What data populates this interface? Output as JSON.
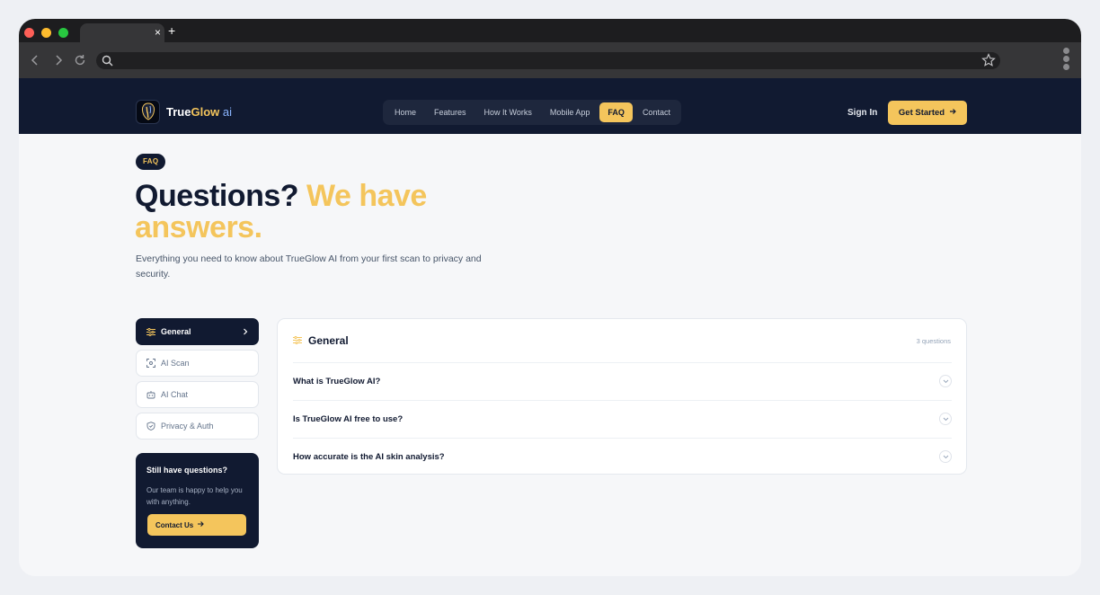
{
  "browser": {
    "tab_close": "×",
    "new_tab": "+"
  },
  "header": {
    "logo": {
      "brand_part1": "True",
      "brand_part2": "Glow",
      "brand_part3": " ai"
    },
    "nav": [
      {
        "label": "Home",
        "active": false
      },
      {
        "label": "Features",
        "active": false
      },
      {
        "label": "How It Works",
        "active": false
      },
      {
        "label": "Mobile App",
        "active": false
      },
      {
        "label": "FAQ",
        "active": true
      },
      {
        "label": "Contact",
        "active": false
      }
    ],
    "sign_in": "Sign In",
    "cta": "Get Started"
  },
  "hero": {
    "badge": "FAQ",
    "title_part1": "Questions?",
    "title_part2": "We have answers.",
    "subtitle": "Everything you need to know about TrueGlow AI from your first scan to privacy and security."
  },
  "sidebar": {
    "categories": [
      {
        "label": "General",
        "icon": "sliders-icon",
        "active": true
      },
      {
        "label": "AI Scan",
        "icon": "scan-icon",
        "active": false
      },
      {
        "label": "AI Chat",
        "icon": "robot-icon",
        "active": false
      },
      {
        "label": "Privacy & Auth",
        "icon": "shield-icon",
        "active": false
      }
    ],
    "help": {
      "title": "Still have questions?",
      "text": "Our team is happy to help you with anything.",
      "button": "Contact Us"
    }
  },
  "faq": {
    "section_title": "General",
    "count": "3 questions",
    "questions": [
      "What is TrueGlow AI?",
      "Is TrueGlow AI free to use?",
      "How accurate is the AI skin analysis?"
    ]
  },
  "colors": {
    "navy": "#111a31",
    "gold": "#f4c55c",
    "page_bg": "#f6f7f9"
  }
}
